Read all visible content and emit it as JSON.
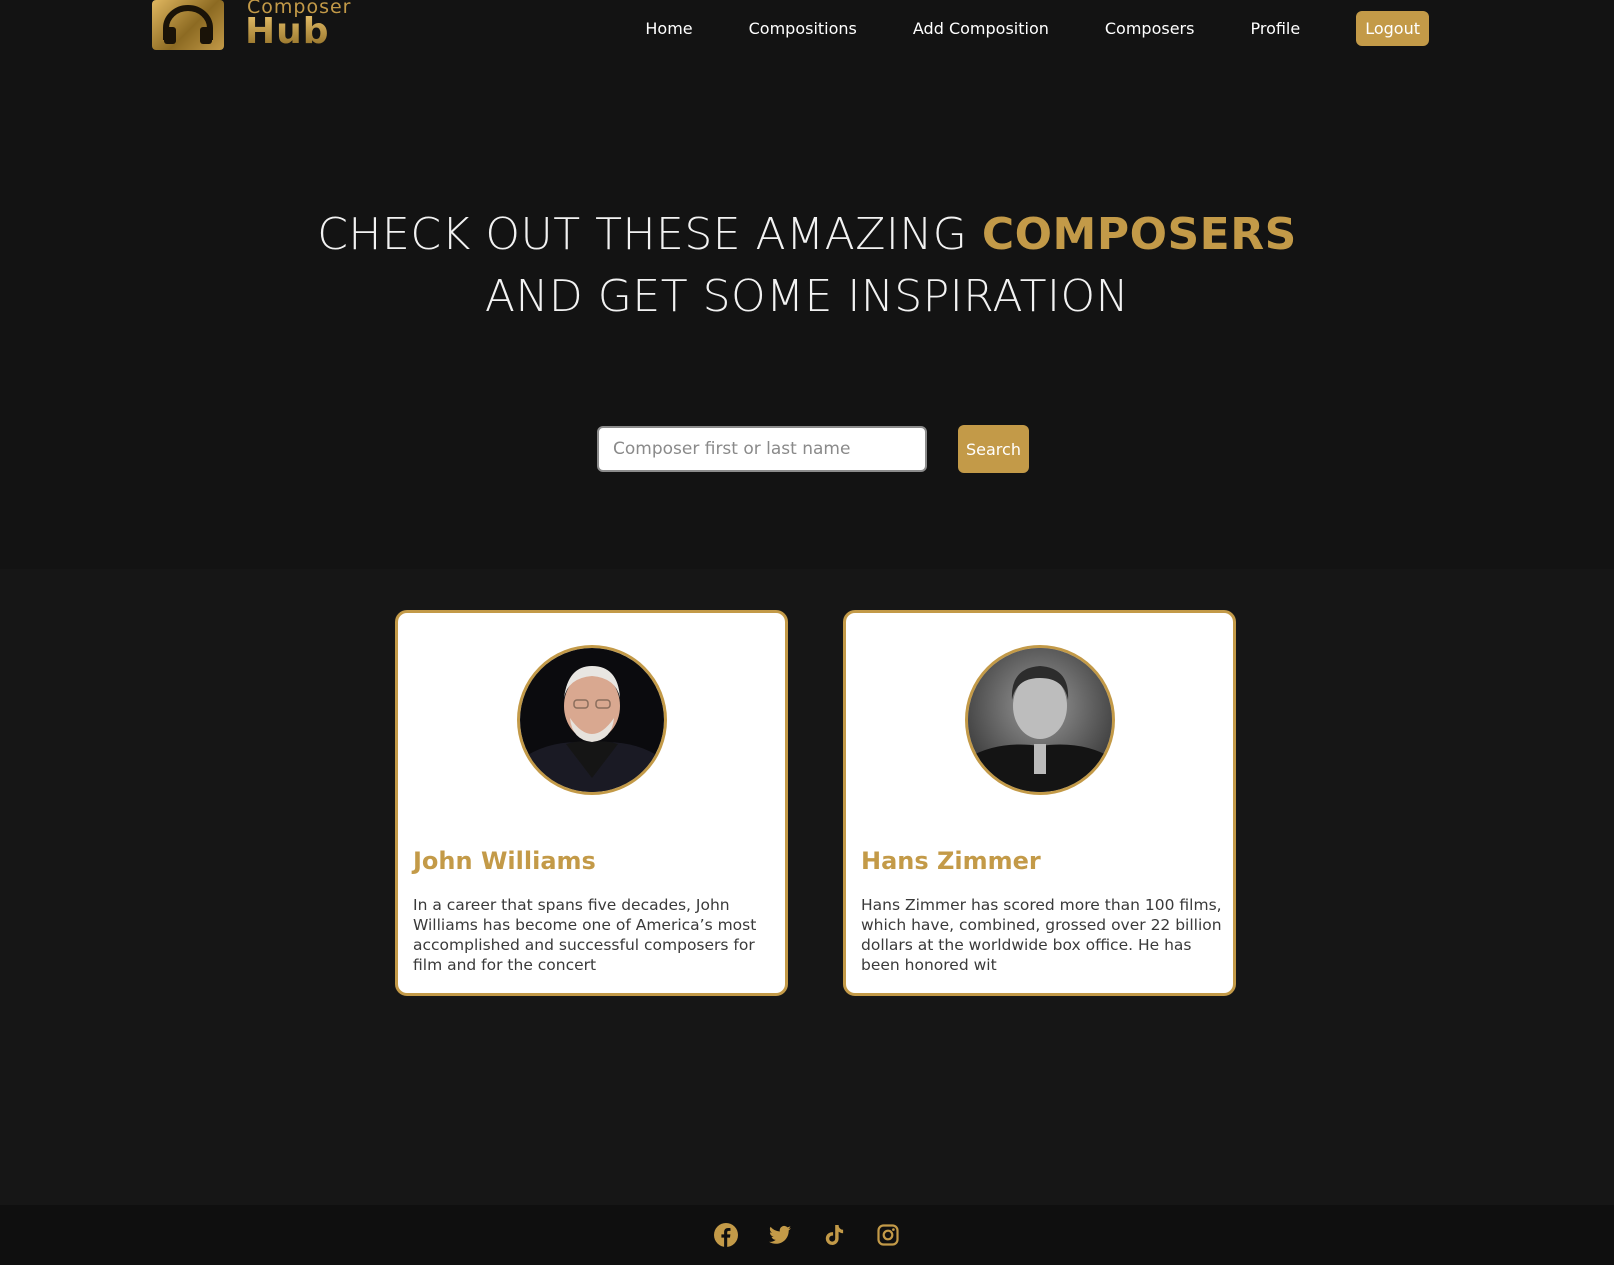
{
  "brand": {
    "line1": "Composer",
    "line2": "Hub",
    "color": "#c39a48"
  },
  "nav": {
    "items": [
      {
        "label": "Home"
      },
      {
        "label": "Compositions"
      },
      {
        "label": "Add Composition"
      },
      {
        "label": "Composers"
      },
      {
        "label": "Profile"
      }
    ],
    "logout_label": "Logout"
  },
  "hero": {
    "title_part1": "CHECK OUT THESE AMAZING ",
    "title_highlight": "COMPOSERS",
    "title_part2": "AND GET SOME INSPIRATION"
  },
  "search": {
    "placeholder": "Composer first or last name",
    "value": "",
    "button_label": "Search"
  },
  "composers": [
    {
      "name": "John Williams",
      "description": "In a career that spans five decades, John Williams has become one of America’s most accomplished and successful composers for film and for the concert"
    },
    {
      "name": "Hans Zimmer",
      "description": "Hans Zimmer has scored more than 100 films, which have, combined, grossed over 22 billion dollars at the worldwide box office. He has been honored wit"
    }
  ],
  "footer": {
    "social_icons": [
      "facebook-icon",
      "twitter-icon",
      "tiktok-icon",
      "instagram-icon"
    ]
  },
  "colors": {
    "accent": "#c39a48",
    "background": "#131313",
    "footer": "#0f0f0f"
  }
}
